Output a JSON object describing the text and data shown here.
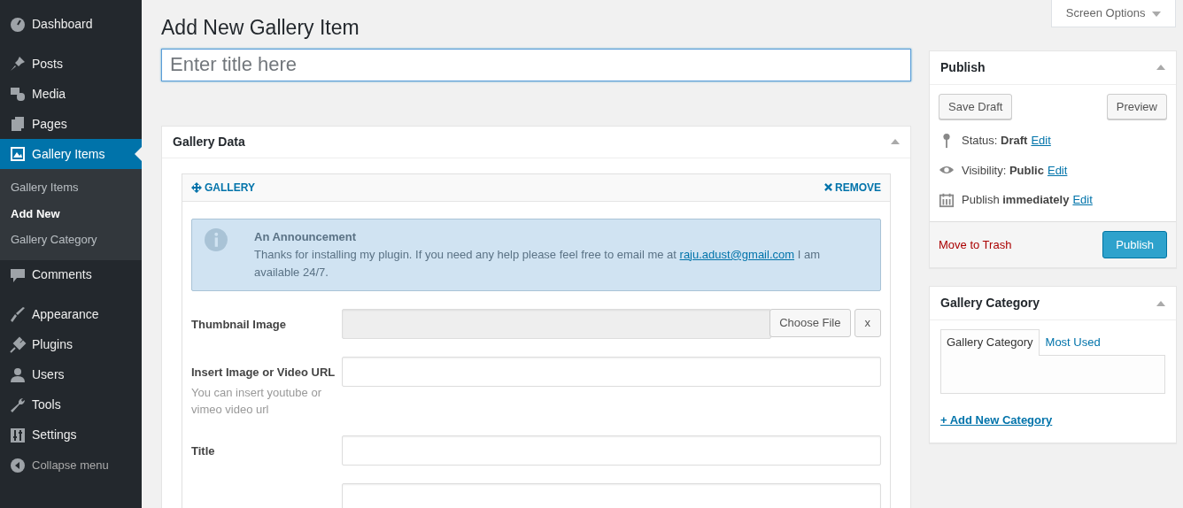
{
  "sidebar": {
    "items": [
      {
        "label": "Dashboard",
        "selected": false
      },
      {
        "label": "Posts",
        "selected": false
      },
      {
        "label": "Media",
        "selected": false
      },
      {
        "label": "Pages",
        "selected": false
      },
      {
        "label": "Gallery Items",
        "selected": true,
        "children": [
          {
            "label": "Gallery Items",
            "selected": false
          },
          {
            "label": "Add New",
            "selected": true
          },
          {
            "label": "Gallery Category",
            "selected": false
          }
        ]
      },
      {
        "label": "Comments",
        "selected": false
      },
      {
        "label": "Appearance",
        "selected": false
      },
      {
        "label": "Plugins",
        "selected": false
      },
      {
        "label": "Users",
        "selected": false
      },
      {
        "label": "Tools",
        "selected": false
      },
      {
        "label": "Settings",
        "selected": false
      }
    ],
    "collapse": "Collapse menu"
  },
  "screen_options": "Screen Options",
  "page_title": "Add New Gallery Item",
  "title_field": {
    "placeholder": "Enter title here"
  },
  "gallery_data": {
    "title": "Gallery Data",
    "group": {
      "label": "GALLERY",
      "remove": "REMOVE"
    },
    "announcement": {
      "title": "An Announcement",
      "text_before": "Thanks for installing my plugin. If you need any help please feel free to email me at",
      "link": "raju.adust@gmail.com",
      "text_after": "I am available 24/7."
    },
    "fields": [
      {
        "kind": "file",
        "label": "Thumbnail Image",
        "button": "Choose File",
        "clear": "x"
      },
      {
        "kind": "text",
        "label": "Insert Image or Video URL",
        "hint": "You can insert youtube or vimeo video url"
      },
      {
        "kind": "text",
        "label": "Title"
      },
      {
        "kind": "text"
      }
    ]
  },
  "publish": {
    "title": "Publish",
    "save_draft": "Save Draft",
    "preview": "Preview",
    "rows": [
      {
        "label": "Status:",
        "value": "Draft",
        "edit": "Edit"
      },
      {
        "label": "Visibility:",
        "value": "Public",
        "edit": "Edit"
      },
      {
        "label": "Publish",
        "value": "immediately",
        "edit": "Edit"
      }
    ],
    "trash": "Move to Trash",
    "publish_button": "Publish"
  },
  "category": {
    "title": "Gallery Category",
    "tabs": [
      {
        "label": "Gallery Category",
        "selected": true
      },
      {
        "label": "Most Used",
        "selected": false
      }
    ],
    "add_link": "+ Add New Category"
  }
}
